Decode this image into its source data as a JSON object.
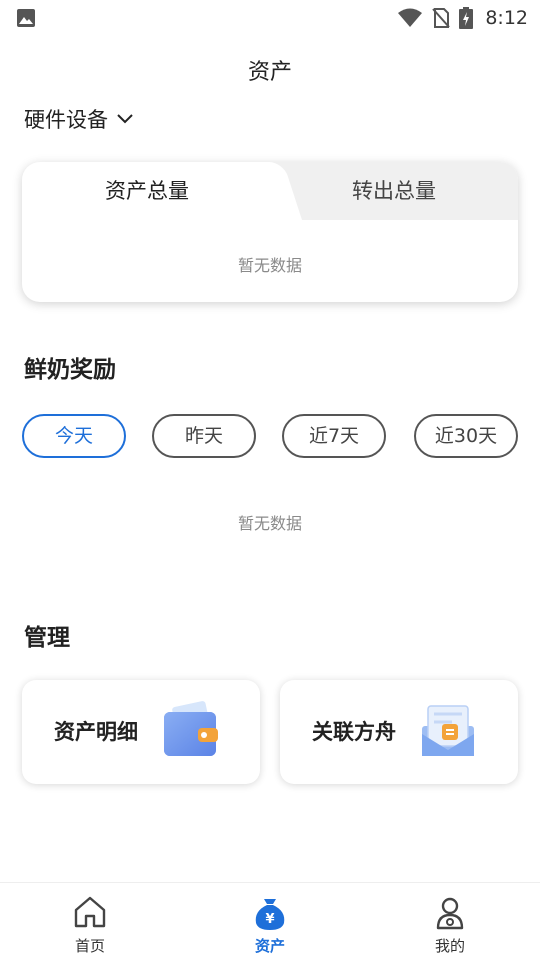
{
  "status_bar": {
    "time": "8:12"
  },
  "page": {
    "title": "资产"
  },
  "device_selector": {
    "label": "硬件设备"
  },
  "asset_card": {
    "tabs": [
      {
        "label": "资产总量",
        "active": true
      },
      {
        "label": "转出总量",
        "active": false
      }
    ],
    "empty_text": "暂无数据"
  },
  "rewards": {
    "title": "鲜奶奖励",
    "ranges": [
      {
        "label": "今天",
        "active": true
      },
      {
        "label": "昨天",
        "active": false
      },
      {
        "label": "近7天",
        "active": false
      },
      {
        "label": "近30天",
        "active": false
      }
    ],
    "empty_text": "暂无数据"
  },
  "management": {
    "title": "管理",
    "items": [
      {
        "label": "资产明细",
        "icon": "wallet-icon"
      },
      {
        "label": "关联方舟",
        "icon": "document-link-icon"
      }
    ]
  },
  "bottom_nav": {
    "items": [
      {
        "label": "首页",
        "icon": "home-icon",
        "active": false
      },
      {
        "label": "资产",
        "icon": "money-bag-icon",
        "active": true
      },
      {
        "label": "我的",
        "icon": "user-icon",
        "active": false
      }
    ]
  },
  "colors": {
    "accent": "#1e6fd9",
    "muted": "#8a8a8a"
  }
}
